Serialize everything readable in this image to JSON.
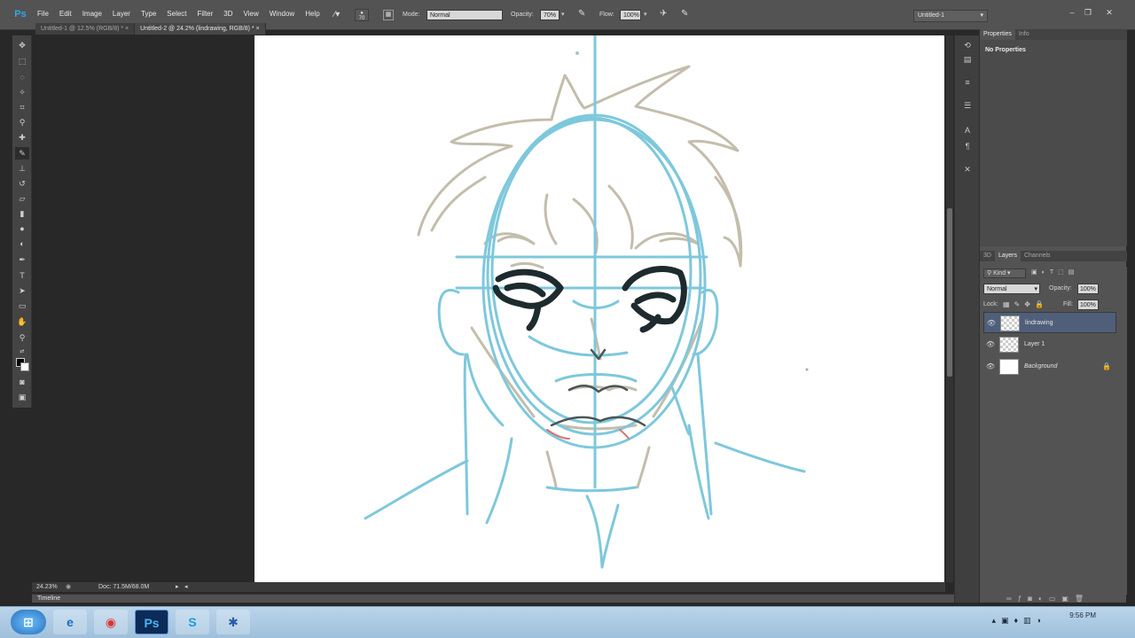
{
  "app": {
    "logo": "Ps"
  },
  "menu": [
    "File",
    "Edit",
    "Image",
    "Layer",
    "Type",
    "Select",
    "Filter",
    "3D",
    "View",
    "Window",
    "Help"
  ],
  "options": {
    "brush_size": "70",
    "mode_label": "Mode:",
    "mode_value": "Normal",
    "opacity_label": "Opacity:",
    "opacity_value": "70%",
    "flow_label": "Flow:",
    "flow_value": "100%"
  },
  "workspace": "Untitled-1",
  "window_buttons": {
    "minimize": "–",
    "restore": "❐",
    "close": "✕"
  },
  "tabs": [
    {
      "label": "Untitled-1 @ 12.5% (RGB/8) *",
      "close": "×"
    },
    {
      "label": "Untitled-2 @ 24.2% (lindrawing, RGB/8) *",
      "close": "×"
    }
  ],
  "status": {
    "zoom": "24.23%",
    "doc": "Doc: 71.5M/68.0M"
  },
  "timeline": {
    "label": "Timeline"
  },
  "properties": {
    "tabs": [
      "Properties",
      "Info"
    ],
    "message": "No Properties"
  },
  "layers": {
    "tabs": [
      "3D",
      "Layers",
      "Channels"
    ],
    "filter_label": "Kind",
    "blend_mode": "Normal",
    "opacity_label": "Opacity:",
    "opacity_value": "100%",
    "lock_label": "Lock:",
    "fill_label": "Fill:",
    "fill_value": "100%",
    "items": [
      {
        "name": "lindrawing",
        "selected": true
      },
      {
        "name": "Layer 1",
        "selected": false
      },
      {
        "name": "Background",
        "selected": false
      }
    ]
  },
  "taskbar": {
    "time": "9:56 PM",
    "icons": [
      "start-orb",
      "internet-explorer",
      "chrome",
      "photoshop",
      "skype",
      "app"
    ]
  },
  "colors": {
    "sketch_blue": "#7ec8dc",
    "sketch_gray": "#c2bba9",
    "ink": "#1e2b2e",
    "accent": "#4f5f7a"
  }
}
